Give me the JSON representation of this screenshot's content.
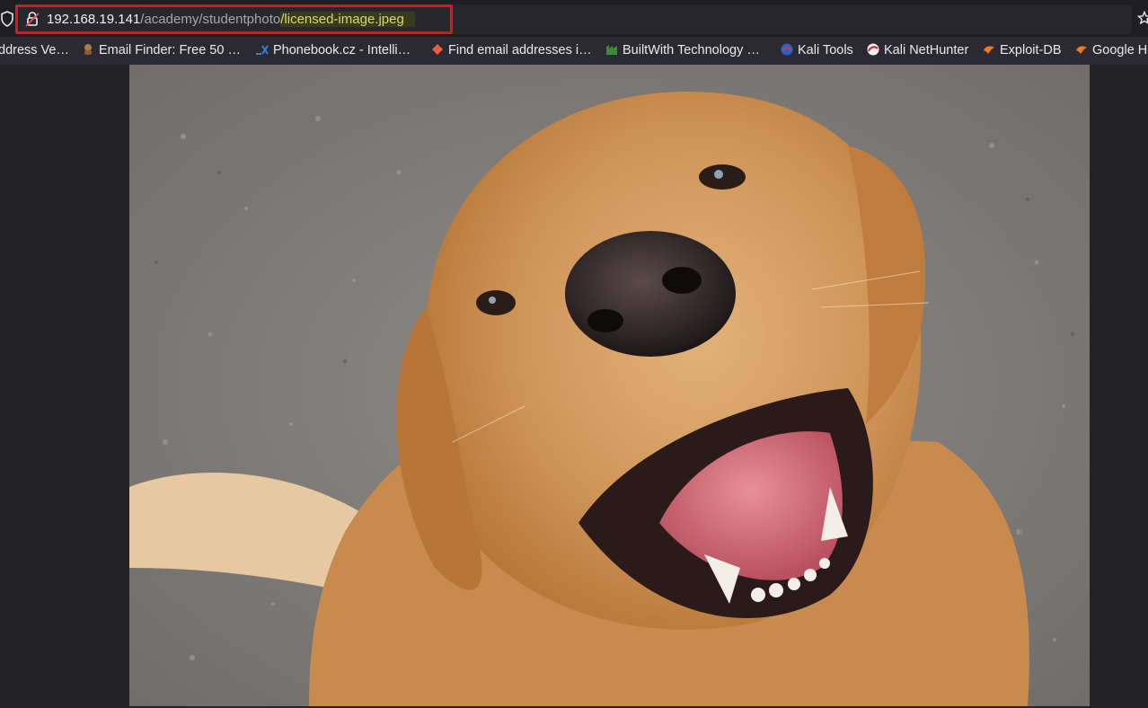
{
  "urlbar": {
    "host": "192.168.19.141",
    "path": "/academy/studentphoto",
    "selected": "/licensed-image.jpeg"
  },
  "bookmarks": [
    {
      "label": "ddress Ve…",
      "icon": "bookmark-icon"
    },
    {
      "label": "Email Finder: Free 50 …",
      "icon": "email-finder-icon"
    },
    {
      "label": "Phonebook.cz - Intelli…",
      "icon": "phonebook-icon"
    },
    {
      "label": "Find email addresses i…",
      "icon": "hunter-icon"
    },
    {
      "label": "BuiltWith Technology …",
      "icon": "builtwith-icon"
    },
    {
      "label": "Kali Tools",
      "icon": "kali-icon"
    },
    {
      "label": "Kali NetHunter",
      "icon": "nethunter-icon"
    },
    {
      "label": "Exploit-DB",
      "icon": "exploitdb-icon"
    },
    {
      "label": "Google H",
      "icon": "ghdb-icon"
    }
  ],
  "image": {
    "description_icon": "dog-photo"
  }
}
